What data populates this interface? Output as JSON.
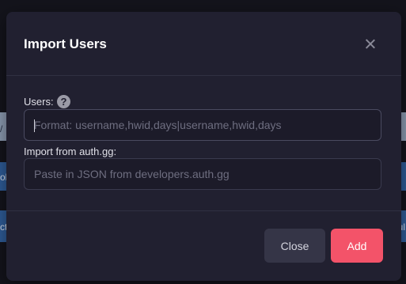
{
  "background": {
    "edge_text_1": "/",
    "edge_text_2": "ol",
    "edge_text_3": "ct",
    "edge_text_4": "ul"
  },
  "modal": {
    "title": "Import Users",
    "users_field": {
      "label": "Users:",
      "placeholder": "Format: username,hwid,days|username,hwid,days",
      "value": ""
    },
    "help_icon_glyph": "?",
    "auth_field": {
      "label": "Import from auth.gg:",
      "placeholder": "Paste in JSON from developers.auth.gg",
      "value": ""
    },
    "buttons": {
      "close_label": "Close",
      "add_label": "Add"
    }
  },
  "colors": {
    "accent": "#f35369",
    "modal_bg": "#212030",
    "secondary_button": "#353547"
  },
  "icons": {
    "close": "close-icon",
    "help": "help-circle-icon"
  }
}
